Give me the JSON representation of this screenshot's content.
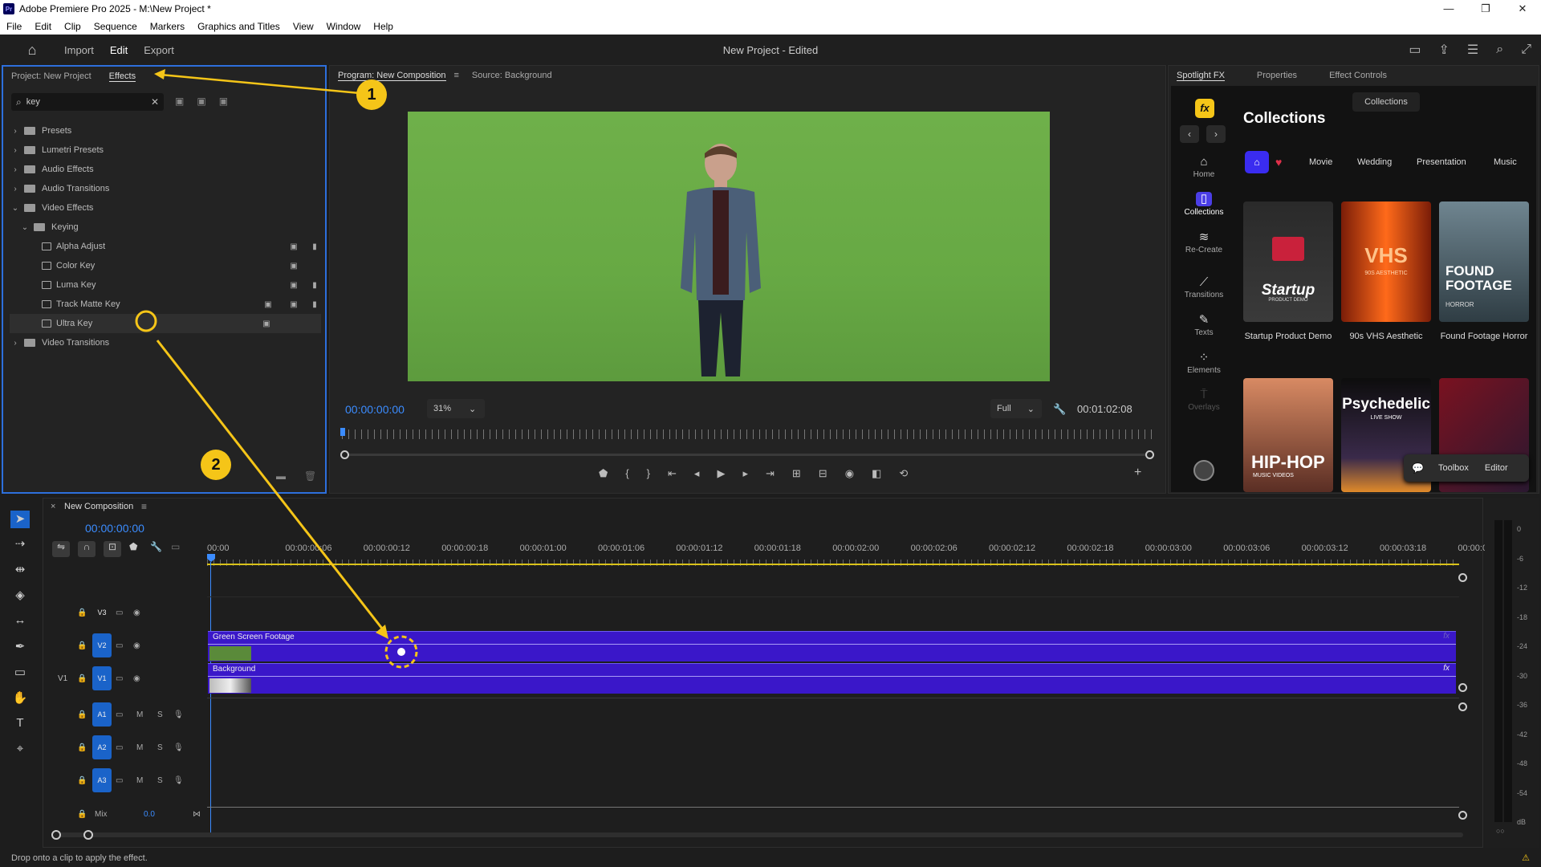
{
  "window": {
    "title": "Adobe Premiere Pro 2025 - M:\\New Project *",
    "logo": "Pr",
    "controls": [
      "—",
      "❐",
      "✕"
    ]
  },
  "menu": [
    "File",
    "Edit",
    "Clip",
    "Sequence",
    "Markers",
    "Graphics and Titles",
    "View",
    "Window",
    "Help"
  ],
  "header": {
    "tabs": [
      "Import",
      "Edit",
      "Export"
    ],
    "active_tab": "Edit",
    "project_title": "New Project - Edited"
  },
  "effects_panel": {
    "tabs": [
      "Project: New Project",
      "Effects"
    ],
    "search_value": "key",
    "tree": [
      {
        "label": "Presets",
        "level": 0,
        "type": "folder",
        "expanded": false
      },
      {
        "label": "Lumetri Presets",
        "level": 0,
        "type": "folder",
        "expanded": false
      },
      {
        "label": "Audio Effects",
        "level": 0,
        "type": "folder",
        "expanded": false
      },
      {
        "label": "Audio Transitions",
        "level": 0,
        "type": "folder",
        "expanded": false
      },
      {
        "label": "Video Effects",
        "level": 0,
        "type": "folder",
        "expanded": true
      },
      {
        "label": "Keying",
        "level": 1,
        "type": "folder",
        "expanded": true
      },
      {
        "label": "Alpha Adjust",
        "level": 2,
        "type": "effect",
        "badges": [
          "32",
          "YUV"
        ]
      },
      {
        "label": "Color Key",
        "level": 2,
        "type": "effect",
        "badges": [
          "32"
        ]
      },
      {
        "label": "Luma Key",
        "level": 2,
        "type": "effect",
        "badges": [
          "",
          "32",
          "YUV"
        ]
      },
      {
        "label": "Track Matte Key",
        "level": 2,
        "type": "effect",
        "badges": [
          "32",
          "32",
          "YUV"
        ]
      },
      {
        "label": "Ultra Key",
        "level": 2,
        "type": "effect",
        "badges": [
          "32"
        ],
        "selected": true
      },
      {
        "label": "Video Transitions",
        "level": 0,
        "type": "folder",
        "expanded": false
      }
    ]
  },
  "program_monitor": {
    "tabs": [
      "Program: New Composition",
      "Source: Background"
    ],
    "timecode": "00:00:00:00",
    "zoom": "31%",
    "quality": "Full",
    "duration": "00:01:02:08"
  },
  "spotlight": {
    "tabs": [
      "Spotlight FX",
      "Properties",
      "Effect Controls"
    ],
    "collections_button": "Collections",
    "heading": "Collections",
    "categories": [
      "Movie",
      "Wedding",
      "Presentation",
      "Music"
    ],
    "side_nav": [
      "Home",
      "Collections",
      "Re-Create",
      "Transitions",
      "Texts",
      "Elements",
      "Overlays"
    ],
    "cards": [
      {
        "title": "Startup Product Demo",
        "art": "Startup",
        "art_sub": "PRODUCT DEMO"
      },
      {
        "title": "90s VHS Aesthetic",
        "art": "VHS",
        "art_sub": "90S AESTHETIC"
      },
      {
        "title": "Found Footage Horror",
        "art": "FOUND FOOTAGE",
        "art_sub": "HORROR"
      },
      {
        "title": "",
        "art": "HIP-HOP",
        "art_sub": "MUSIC VIDEOS"
      },
      {
        "title": "",
        "art": "Psychedelic",
        "art_sub": "LIVE SHOW"
      },
      {
        "title": "",
        "art": "",
        "art_sub": ""
      }
    ],
    "toolbox_label": "Toolbox",
    "editor_label": "Editor"
  },
  "timeline": {
    "sequence_name": "New Composition",
    "timecode": "00:00:00:00",
    "ruler": [
      "00:00",
      "00:00:00:06",
      "00:00:00:12",
      "00:00:00:18",
      "00:00:01:00",
      "00:00:01:06",
      "00:00:01:12",
      "00:00:01:18",
      "00:00:02:00",
      "00:00:02:06",
      "00:00:02:12",
      "00:00:02:18",
      "00:00:03:00",
      "00:00:03:06",
      "00:00:03:12",
      "00:00:03:18",
      "00:00:0"
    ],
    "video_tracks": [
      "V3",
      "V2",
      "V1"
    ],
    "audio_tracks": [
      "A1",
      "A2",
      "A3"
    ],
    "source_patch": "V1",
    "mix_label": "Mix",
    "mix_value": "0.0",
    "clips": [
      {
        "name": "Green Screen Footage",
        "track": "V2",
        "fx": "fx"
      },
      {
        "name": "Background",
        "track": "V1",
        "fx": "fx"
      }
    ],
    "meter_scale": [
      "0",
      "-6",
      "-12",
      "-18",
      "-24",
      "-30",
      "-36",
      "-42",
      "-48",
      "-54",
      "dB"
    ]
  },
  "annotations": [
    "1",
    "2"
  ],
  "status": "Drop onto a clip to apply the effect.",
  "colors": {
    "accent": "#2d6fdc",
    "clip": "#3a17c9",
    "annotation": "#f5c518",
    "timecode": "#3b8cff"
  }
}
